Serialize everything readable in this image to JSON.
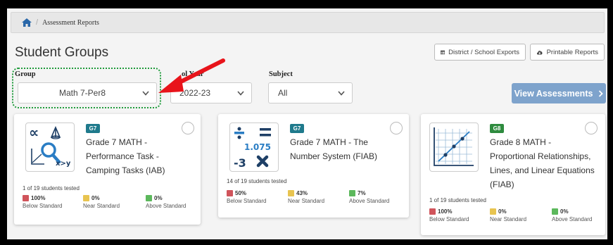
{
  "breadcrumb": {
    "home_icon": "home-icon",
    "separator": "/",
    "current": "Assessment Reports"
  },
  "page": {
    "title": "Student Groups"
  },
  "header_buttons": {
    "district_exports": {
      "label": "District / School Exports",
      "icon": "table-icon"
    },
    "printable_reports": {
      "label": "Printable Reports",
      "icon": "cloud-download-icon"
    }
  },
  "filters": {
    "group": {
      "label": "Group",
      "value": "Math 7-Per8"
    },
    "school_year": {
      "label": "ol Year",
      "value": "2022-23"
    },
    "subject": {
      "label": "Subject",
      "value": "All"
    }
  },
  "view_assessments": {
    "label": "View Assessments",
    "icon": "chevron-right-icon"
  },
  "annotation": {
    "arrow_color": "#e8141b",
    "highlight_color": "#1f9b3b"
  },
  "cards": [
    {
      "badge": "G7",
      "badge_color": "#1f7a8c",
      "title_lines": [
        "Grade 7 MATH -",
        "Performance Task -",
        "Camping Tasks (IAB)"
      ],
      "tested": "1 of 19 students tested",
      "stats": [
        {
          "pct": "100%",
          "label": "Below Standard",
          "color": "#d0545b"
        },
        {
          "pct": "0%",
          "label": "Near Standard",
          "color": "#e8c450"
        },
        {
          "pct": "0%",
          "label": "Above Standard",
          "color": "#5cb85c"
        }
      ]
    },
    {
      "badge": "G7",
      "badge_color": "#1f7a8c",
      "title_lines": [
        "Grade 7 MATH - The",
        "Number System (FIAB)"
      ],
      "tested": "14 of 19 students tested",
      "icon_value": "1.075",
      "icon_neg": "-3",
      "stats": [
        {
          "pct": "50%",
          "label": "Below Standard",
          "color": "#d0545b"
        },
        {
          "pct": "43%",
          "label": "Near Standard",
          "color": "#e8c450"
        },
        {
          "pct": "7%",
          "label": "Above Standard",
          "color": "#5cb85c"
        }
      ]
    },
    {
      "badge": "G8",
      "badge_color": "#2e8b3e",
      "title_lines": [
        "Grade 8 MATH -",
        "Proportional Relationships,",
        "Lines, and Linear Equations",
        "(FIAB)"
      ],
      "tested": "1 of 19 students tested",
      "stats": [
        {
          "pct": "100%",
          "label": "Below Standard",
          "color": "#d0545b"
        },
        {
          "pct": "0%",
          "label": "Near Standard",
          "color": "#e8c450"
        },
        {
          "pct": "0%",
          "label": "Above Standard",
          "color": "#5cb85c"
        }
      ]
    }
  ]
}
